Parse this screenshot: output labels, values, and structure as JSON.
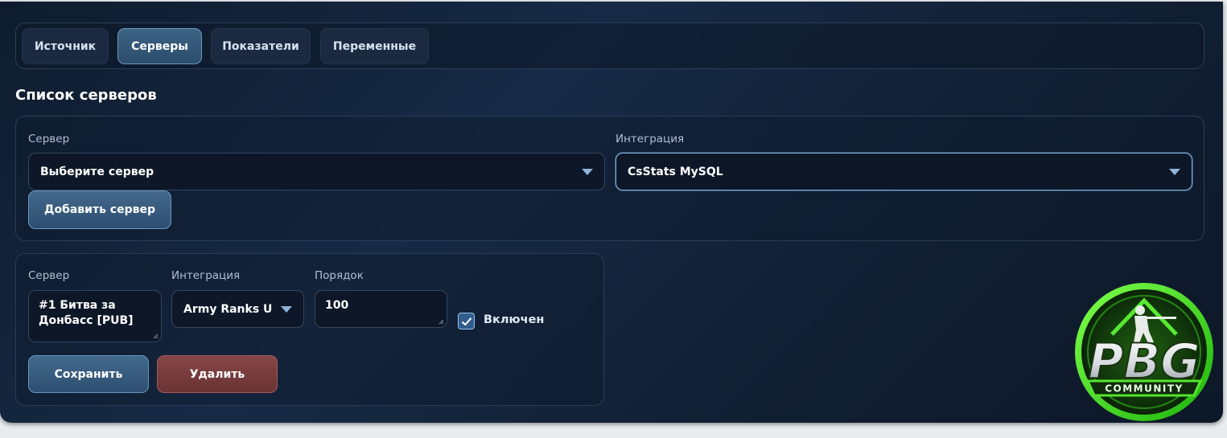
{
  "tabs": [
    {
      "label": "Источник",
      "active": false
    },
    {
      "label": "Серверы",
      "active": true
    },
    {
      "label": "Показатели",
      "active": false
    },
    {
      "label": "Переменные",
      "active": false
    }
  ],
  "section_title": "Список серверов",
  "add_form": {
    "server_label": "Сервер",
    "server_value": "Выберите сервер",
    "integration_label": "Интеграция",
    "integration_value": "CsStats MySQL",
    "add_button": "Добавить сервер"
  },
  "server_entry": {
    "server_label": "Сервер",
    "server_value": "#1 Битва за Донбасс [PUB]",
    "integration_label": "Интеграция",
    "integration_value": "Army Ranks U",
    "order_label": "Порядок",
    "order_value": "100",
    "enabled_label": "Включен",
    "enabled": true,
    "save_button": "Сохранить",
    "delete_button": "Удалить"
  },
  "logo": {
    "text": "PBG",
    "subtext": "COMMUNITY"
  },
  "colors": {
    "background": "#13233a",
    "accent": "#3d6385",
    "danger": "#864646",
    "logo_green": "#39e01a"
  }
}
